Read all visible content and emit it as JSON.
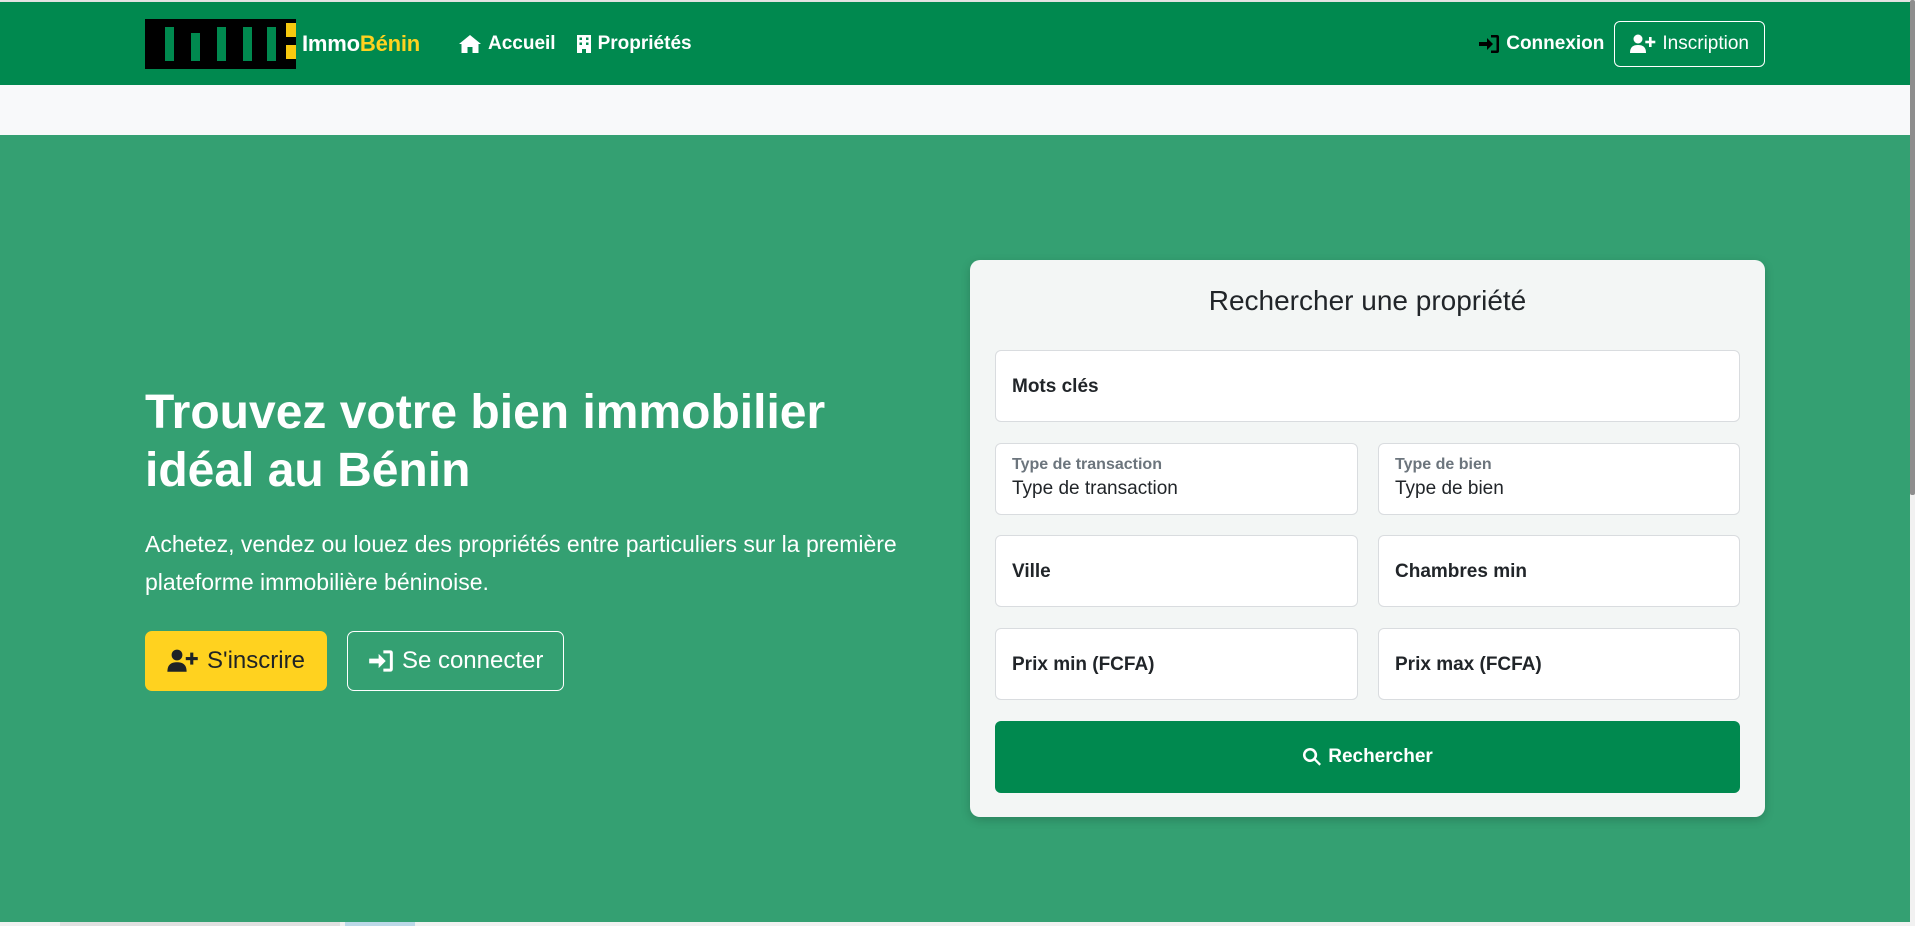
{
  "brand": {
    "name_primary": "Immo",
    "name_accent": "Bénin",
    "logo_icon": "building-logo-icon",
    "colors": {
      "primary_green": "#00894f",
      "accent_yellow": "#ffd21f",
      "hero_green": "#34a072"
    }
  },
  "nav": {
    "links": [
      {
        "label": "Accueil",
        "icon": "home-icon"
      },
      {
        "label": "Propriétés",
        "icon": "building-icon"
      }
    ],
    "login_label": "Connexion",
    "login_icon": "sign-in-icon",
    "register_label": "Inscription",
    "register_icon": "user-plus-icon"
  },
  "hero": {
    "title": "Trouvez votre bien immobilier idéal au Bénin",
    "subtitle": "Achetez, vendez ou louez des propriétés entre particuliers sur la première plateforme immobilière béninoise.",
    "signup_label": "S'inscrire",
    "signup_icon": "user-plus-icon",
    "signin_label": "Se connecter",
    "signin_icon": "sign-in-icon"
  },
  "search": {
    "title": "Rechercher une propriété",
    "keywords_label": "Mots clés",
    "transaction_label": "Type de transaction",
    "transaction_value": "Type de transaction",
    "property_type_label": "Type de bien",
    "property_type_value": "Type de bien",
    "city_label": "Ville",
    "bedrooms_label": "Chambres min",
    "price_min_label": "Prix min (FCFA)",
    "price_max_label": "Prix max (FCFA)",
    "submit_label": "Rechercher",
    "submit_icon": "search-icon"
  }
}
